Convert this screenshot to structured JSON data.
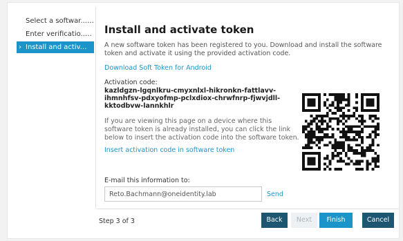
{
  "wizard_steps": [
    {
      "label": "Select a softwar...",
      "status": "✓"
    },
    {
      "label": "Enter verificatio...",
      "status": "✓"
    },
    {
      "label": "Install and activ...",
      "status": ""
    }
  ],
  "main": {
    "title": "Install and activate token",
    "intro": "A new software token has been registered to you. Download and install the software token and activate it using the provided activation code.",
    "download_link": "Download Soft Token for Android",
    "activation_label": "Activation code:",
    "activation_code": "kazldgzn-lgqnlkru-cmyxnlxl-hikronkn-fattlavv-ihmnhfsv-pdxyofmp-pclxdiox-chrwfnrp-fjwvjdll-kktodbvw-lannkhlr",
    "device_text": "If you are viewing this page on a device where this software token is already installed, you can click the link below to insert the activation code into the software token.",
    "insert_link": "Insert activation code in software token"
  },
  "email": {
    "label": "E-mail this information to:",
    "value": "Reto.Bachmann@oneidentity.lab",
    "send_label": "Send"
  },
  "footer": {
    "step_count": "Step 3 of 3",
    "back_label": "Back",
    "next_label": "Next",
    "finish_label": "Finish",
    "cancel_label": "Cancel"
  },
  "colors": {
    "accent": "#1b95c9",
    "dark_button": "#1c5671",
    "disabled_button": "#eef1f3"
  },
  "icons": {
    "check": "check-icon",
    "chevron": "chevron-right-icon",
    "qr": "qr-code"
  }
}
